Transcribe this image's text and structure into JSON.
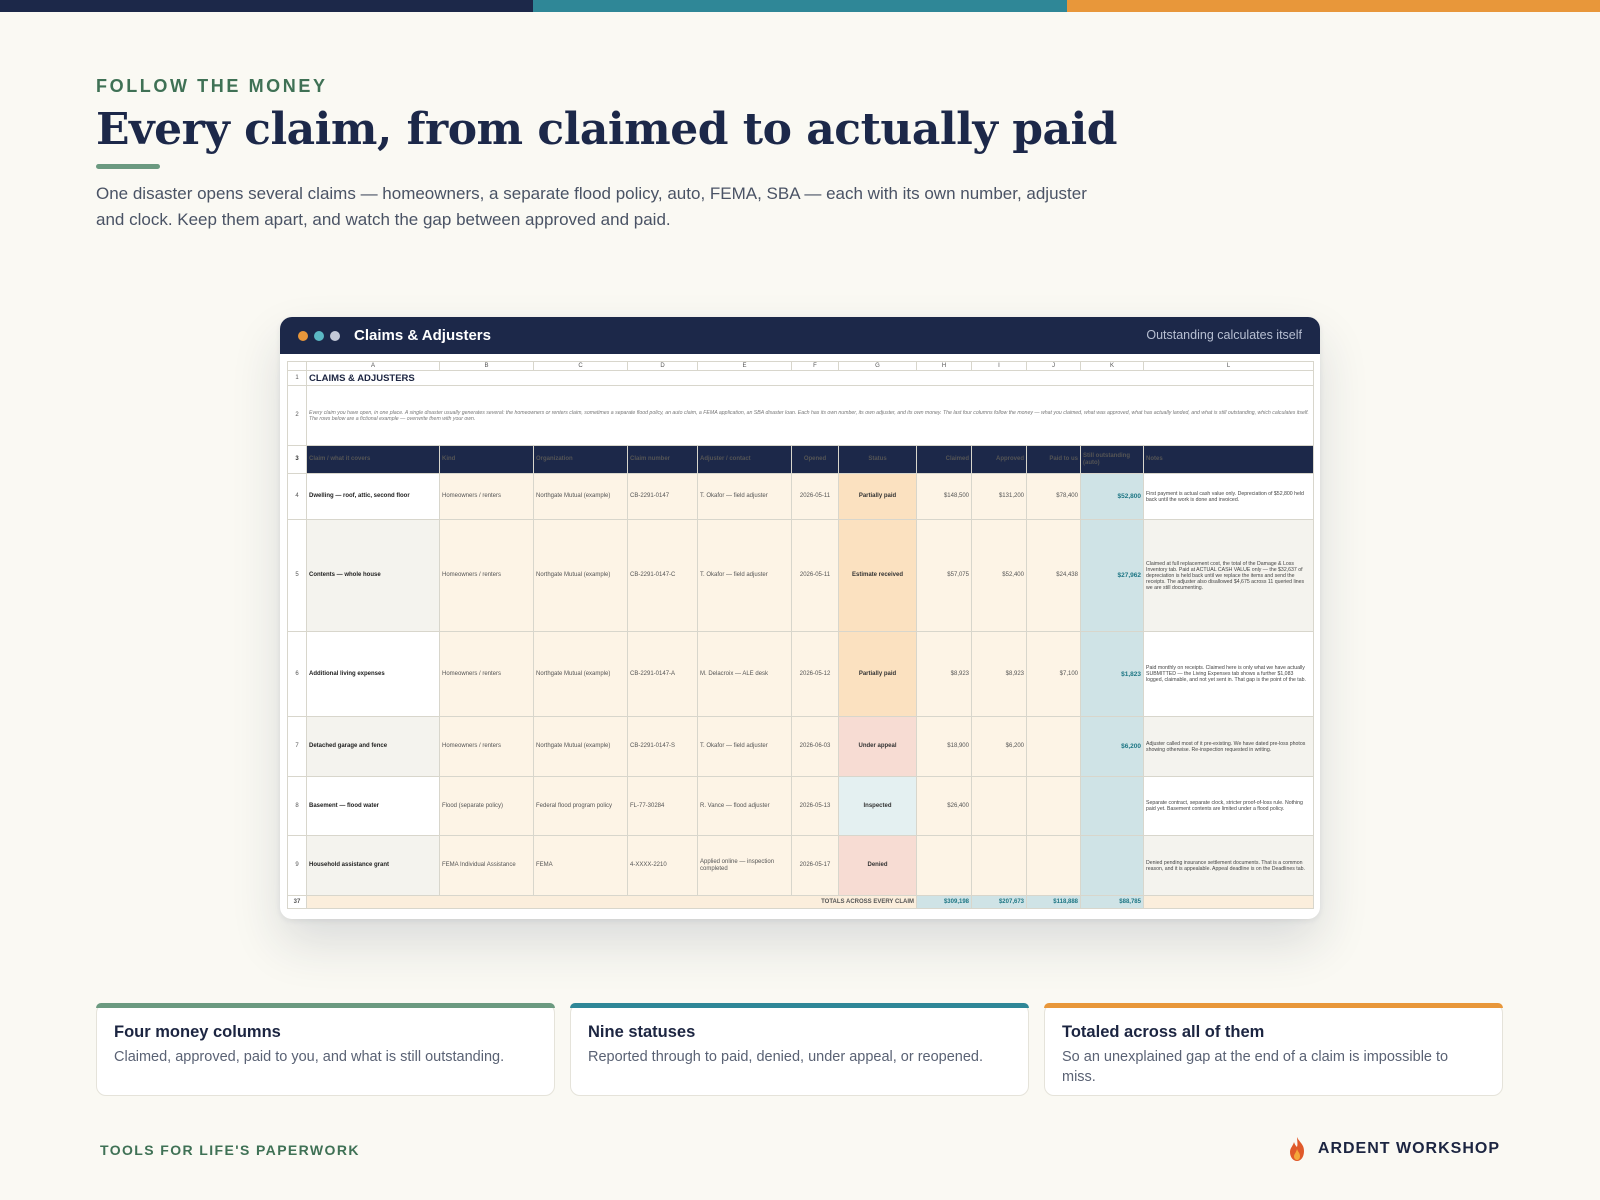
{
  "colors": {
    "navy": "#1c2849",
    "teal": "#2f8797",
    "orange": "#e8973a",
    "green": "#3f7155"
  },
  "eyebrow": "FOLLOW THE MONEY",
  "title": "Every claim, from claimed to actually paid",
  "subtitle": "One disaster opens several claims — homeowners, a separate flood policy, auto, FEMA, SBA — each with its own number, adjuster and clock. Keep them apart, and watch the gap between approved and paid.",
  "window": {
    "title": "Claims & Adjusters",
    "note": "Outstanding calculates itself",
    "dot_colors": [
      "#e8973a",
      "#5bb8c4",
      "#c3c9d8"
    ]
  },
  "sheet": {
    "columns": [
      "A",
      "B",
      "C",
      "D",
      "E",
      "F",
      "G",
      "H",
      "I",
      "J",
      "K",
      "L"
    ],
    "row_numbers": [
      "1",
      "2",
      "3",
      "4",
      "5",
      "6",
      "7",
      "8",
      "9",
      "37"
    ],
    "title": "CLAIMS & ADJUSTERS",
    "intro": "Every claim you have open, in one place. A single disaster usually generates several: the homeowners or renters claim, sometimes a separate flood policy, an auto claim, a FEMA application, an SBA disaster loan. Each has its own number, its own adjuster, and its own money. The last four columns follow the money — what you claimed, what was approved, what has actually landed, and what is still outstanding, which calculates itself. The rows below are a fictional example — overwrite them with your own.",
    "headers": [
      "Claim / what it covers",
      "Kind",
      "Organization",
      "Claim number",
      "Adjuster / contact",
      "Opened",
      "Status",
      "Claimed",
      "Approved",
      "Paid to us",
      "Still outstanding (auto)",
      "Notes"
    ],
    "rows": [
      {
        "claim": "Dwelling — roof, attic, second floor",
        "kind": "Homeowners / renters",
        "org": "Northgate Mutual (example)",
        "number": "CB-2291-0147",
        "adjuster": "T. Okafor — field adjuster",
        "opened": "2026-05-11",
        "status": "Partially paid",
        "claimed": "$148,500",
        "approved": "$131,200",
        "paid": "$78,400",
        "outstanding": "$52,800",
        "notes": "First payment is actual cash value only. Depreciation of $52,800 held back until the work is done and invoiced."
      },
      {
        "claim": "Contents — whole house",
        "kind": "Homeowners / renters",
        "org": "Northgate Mutual (example)",
        "number": "CB-2291-0147-C",
        "adjuster": "T. Okafor — field adjuster",
        "opened": "2026-05-11",
        "status": "Estimate received",
        "claimed": "$57,075",
        "approved": "$52,400",
        "paid": "$24,438",
        "outstanding": "$27,962",
        "notes": "Claimed at full replacement cost, the total of the Damage & Loss Inventory tab. Paid at ACTUAL CASH VALUE only — the $32,637 of depreciation is held back until we replace the items and send the receipts. The adjuster also disallowed $4,675 across 11 queried lines we are still documenting."
      },
      {
        "claim": "Additional living expenses",
        "kind": "Homeowners / renters",
        "org": "Northgate Mutual (example)",
        "number": "CB-2291-0147-A",
        "adjuster": "M. Delacroix — ALE desk",
        "opened": "2026-05-12",
        "status": "Partially paid",
        "claimed": "$8,923",
        "approved": "$8,923",
        "paid": "$7,100",
        "outstanding": "$1,823",
        "notes": "Paid monthly on receipts. Claimed here is only what we have actually SUBMITTED — the Living Expenses tab shows a further $1,083 logged, claimable, and not yet sent in. That gap is the point of the tab."
      },
      {
        "claim": "Detached garage and fence",
        "kind": "Homeowners / renters",
        "org": "Northgate Mutual (example)",
        "number": "CB-2291-0147-S",
        "adjuster": "T. Okafor — field adjuster",
        "opened": "2026-06-03",
        "status": "Under appeal",
        "claimed": "$18,900",
        "approved": "$6,200",
        "paid": "",
        "outstanding": "$6,200",
        "notes": "Adjuster called most of it pre-existing. We have dated pre-loss photos showing otherwise. Re-inspection requested in writing."
      },
      {
        "claim": "Basement — flood water",
        "kind": "Flood (separate policy)",
        "org": "Federal flood program policy",
        "number": "FL-77-30284",
        "adjuster": "R. Vance — flood adjuster",
        "opened": "2026-05-13",
        "status": "Inspected",
        "claimed": "$26,400",
        "approved": "",
        "paid": "",
        "outstanding": "",
        "notes": "Separate contract, separate clock, stricter proof-of-loss rule. Nothing paid yet. Basement contents are limited under a flood policy."
      },
      {
        "claim": "Household assistance grant",
        "kind": "FEMA Individual Assistance",
        "org": "FEMA",
        "number": "4-XXXX-2210",
        "adjuster": "Applied online — inspection completed",
        "opened": "2026-05-17",
        "status": "Denied",
        "claimed": "",
        "approved": "",
        "paid": "",
        "outstanding": "",
        "notes": "Denied pending insurance settlement documents. That is a common reason, and it is appealable. Appeal deadline is on the Deadlines tab."
      }
    ],
    "status_colors": {
      "Partially paid": "#fbe1c0",
      "Estimate received": "#fbe1c0",
      "Under appeal": "#f7dcd3",
      "Inspected": "#e4f0f1",
      "Denied": "#f7dcd3"
    },
    "totals": {
      "label": "TOTALS ACROSS EVERY CLAIM",
      "claimed": "$309,198",
      "approved": "$207,673",
      "paid": "$118,888",
      "outstanding": "$88,785"
    }
  },
  "cards": [
    {
      "title": "Four money columns",
      "text": "Claimed, approved, paid to you, and what is still outstanding.",
      "color": "#6b9a80"
    },
    {
      "title": "Nine statuses",
      "text": "Reported through to paid, denied, under appeal, or reopened.",
      "color": "#2f8797"
    },
    {
      "title": "Totaled across all of them",
      "text": "So an unexplained gap at the end of a claim is impossible to miss.",
      "color": "#e8973a"
    }
  ],
  "footer": {
    "left": "TOOLS FOR LIFE'S PAPERWORK",
    "brand": "ARDENT WORKSHOP",
    "brand_icon": "flame-icon"
  }
}
